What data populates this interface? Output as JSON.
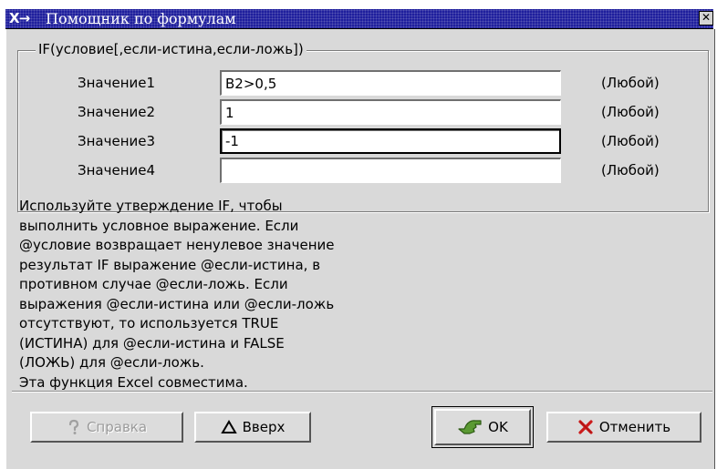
{
  "window": {
    "title": "Помощник по формулам",
    "app_icon": "X→",
    "close_glyph": "✕"
  },
  "function_signature": "IF(условие[,если-истина,если-ложь])",
  "params": [
    {
      "label": "Значение1",
      "value": "B2>0,5",
      "type": "(Любой)"
    },
    {
      "label": "Значение2",
      "value": "1",
      "type": "(Любой)"
    },
    {
      "label": "Значение3",
      "value": "-1",
      "type": "(Любой)"
    },
    {
      "label": "Значение4",
      "value": "",
      "type": "(Любой)"
    }
  ],
  "description": [
    "Используйте утверждение IF, чтобы",
    "выполнить условное выражение. Если",
    "@условие возвращает ненулевое значение",
    "результат IF выражение @если-истина, в",
    "противном случае @если-ложь. Если",
    "выражения @если-истина или @если-ложь",
    "отсутствуют, то используется TRUE",
    "(ИСТИНА) для @если-истина и FALSE",
    "(ЛОЖЬ) для @если-ложь.",
    "Эта функция Excel совместима."
  ],
  "buttons": {
    "help": "Справка",
    "up": "Вверх",
    "ok": "OK",
    "cancel": "Отменить"
  },
  "icons": {
    "help": "question-icon",
    "up": "triangle-up-icon",
    "ok": "check-hand-icon",
    "cancel": "x-icon"
  },
  "colors": {
    "titlebar": "#1d1d9c",
    "dialog_bg": "#d9d9d9",
    "ok_icon": "#4d8a2c",
    "cancel_icon": "#cc1b1b"
  }
}
